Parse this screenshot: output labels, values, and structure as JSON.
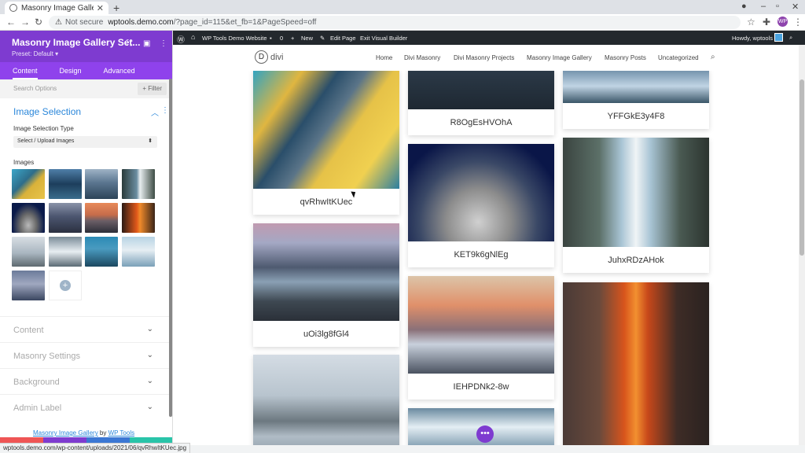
{
  "browser": {
    "tab_title": "Masonry Image Gallery | W",
    "security_label": "Not secure",
    "url_host": "wptools.demo.com",
    "url_path": "/?page_id=115&et_fb=1&PageSpeed=off",
    "profile_initials": "WP",
    "status_url": "wptools.demo.com/wp-content/uploads/2021/06/qvRhwItKUec.jpg"
  },
  "panel": {
    "title": "Masonry Image Gallery Set...",
    "preset": "Preset: Default ▾",
    "tabs": [
      "Content",
      "Design",
      "Advanced"
    ],
    "search_placeholder": "Search Options",
    "filter_label": "Filter",
    "section_title": "Image Selection",
    "selection_type_label": "Image Selection Type",
    "selection_type_value": "Select / Upload Images",
    "images_label": "Images",
    "collapsed_sections": [
      "Content",
      "Masonry Settings",
      "Background",
      "Admin Label"
    ],
    "credit_link": "Masonry Image Gallery",
    "credit_by": " by ",
    "credit_author": "WP Tools"
  },
  "adminbar": {
    "site_name": "WP Tools Demo Website",
    "comments": "0",
    "new": "New",
    "edit_page": "Edit Page",
    "exit_builder": "Exit Visual Builder",
    "howdy": "Howdy, wptools"
  },
  "site": {
    "logo_letter": "D",
    "logo_word": "divi",
    "menu": [
      "Home",
      "Divi Masonry",
      "Divi Masonry Projects",
      "Masonry Image Gallery",
      "Masonry Posts",
      "Uncategorized"
    ]
  },
  "gallery": {
    "captions": [
      "qvRhwItKUec",
      "uOi3lg8fGl4",
      "R8OgEsHVOhA",
      "KET9k6gNlEg",
      "IEHPDNk2-8w",
      "YFFGkE3y4F8",
      "JuhxRDzAHok"
    ]
  },
  "builder": {
    "fab_label": "•••"
  }
}
